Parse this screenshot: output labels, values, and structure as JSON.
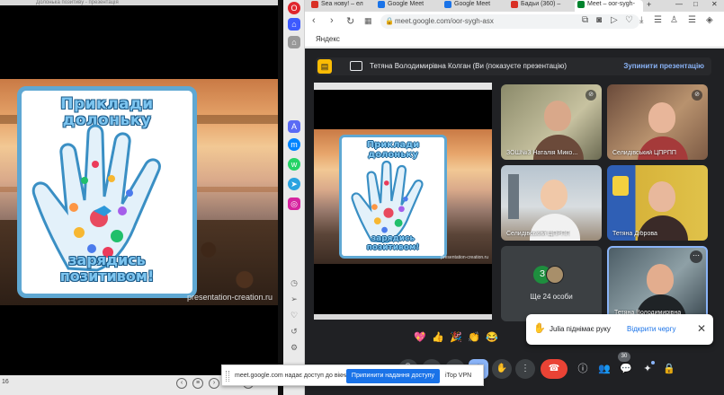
{
  "left_window": {
    "title": "Долонька позитиву - презентація",
    "slide": {
      "title": "Приклади долоньку",
      "bottom_text": "зарядись позитивом!",
      "footer": "presentation-creation.ru"
    },
    "page_number": "16"
  },
  "browser": {
    "tabs": [
      {
        "label": "Sea нову! – ел",
        "favicon_color": "#d93025"
      },
      {
        "label": "Google Meet",
        "favicon_color": "#1a73e8"
      },
      {
        "label": "Google Meet",
        "favicon_color": "#1a73e8"
      },
      {
        "label": "Бадьи (360) –",
        "favicon_color": "#d93025"
      },
      {
        "label": "Meet – oor-sygh-",
        "favicon_color": "#00832d"
      }
    ],
    "url": "meet.google.com/oor-sygh-asx",
    "bookmark": "Яндекс"
  },
  "meet": {
    "banner": {
      "presenter_text": "Тетяна Володимирівна Колган (Ви (показуєте презентацію)",
      "stop_label": "Зупинити презентацію"
    },
    "main_tile": {
      "slide_title": "Приклади долоньку",
      "slide_bottom": "зарядись позитивом!",
      "footer": "presentation-creation.ru"
    },
    "participants": [
      {
        "name": "ЗОШ№3 Наталія Мико..."
      },
      {
        "name": "Селидівський ЦПРПП"
      },
      {
        "name": "Селидівський ЦПРПП"
      },
      {
        "name": "Тетяна Діброва"
      },
      {
        "name": "Тетяна Володимирівна"
      }
    ],
    "more": {
      "count_avatar": "З",
      "label": "Ще 24 особи"
    },
    "hand_toast": {
      "text": "Julia піднімає руку",
      "action": "Відкрити чергу"
    },
    "reactions": [
      "💖",
      "👍",
      "🎉",
      "👏",
      "😂"
    ],
    "people_count": "30"
  },
  "share_bar": {
    "message": "meet.google.com надає доступ до вікна.",
    "stop_label": "Припинити надання доступу",
    "vpn": "iTop VPN"
  },
  "colors": {
    "meet_bg": "#202124",
    "accent": "#8ab4f8",
    "hangup": "#ea4335",
    "slide_border": "#5fa8d3"
  }
}
